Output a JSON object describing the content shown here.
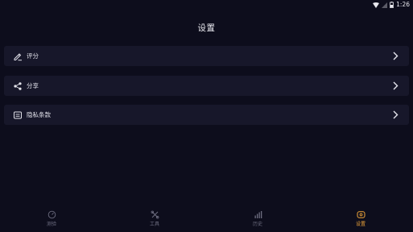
{
  "status_bar": {
    "time": "1:26",
    "icons": [
      "wifi-icon",
      "signal-icon",
      "battery-icon"
    ]
  },
  "header": {
    "title": "设置"
  },
  "menu": {
    "items": [
      {
        "label": "评分",
        "icon": "edit-pen-icon"
      },
      {
        "label": "分享",
        "icon": "share-icon"
      },
      {
        "label": "隐私条款",
        "icon": "privacy-document-icon"
      }
    ]
  },
  "tab_bar": {
    "tabs": [
      {
        "label": "测验",
        "icon": "gauge-icon",
        "active": false
      },
      {
        "label": "工具",
        "icon": "tools-icon",
        "active": false
      },
      {
        "label": "历史",
        "icon": "bar-chart-icon",
        "active": false
      },
      {
        "label": "设置",
        "icon": "settings-icon",
        "active": true
      }
    ]
  },
  "colors": {
    "background": "#0d0d1c",
    "card": "#17172a",
    "accent": "#f0a53a",
    "inactive": "#6d6d80"
  }
}
